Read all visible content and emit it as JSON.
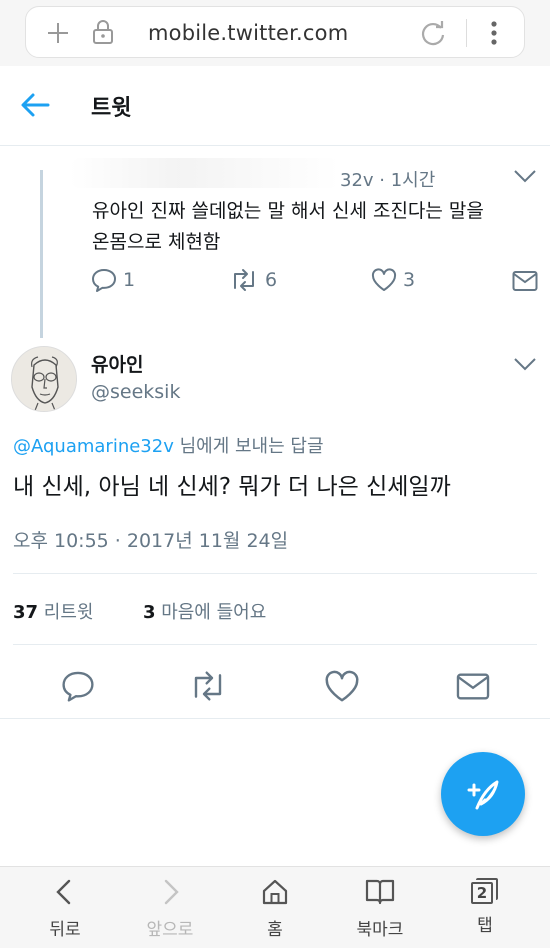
{
  "browser": {
    "url": "mobile.twitter.com",
    "icons": [
      "plus-icon",
      "lock-icon",
      "reload-icon",
      "more-vertical-icon"
    ]
  },
  "header": {
    "title": "트윗"
  },
  "parent_tweet": {
    "meta": "32v · 1시간",
    "text_line1": "유아인 진짜 쓸데없는 말 해서 신세 조진다는 말을",
    "text_line2": "온몸으로 체현함",
    "reply_count": "1",
    "retweet_count": "6",
    "like_count": "3"
  },
  "tweet": {
    "author_name": "유아인",
    "author_handle": "@seeksik",
    "reply_to_mention": "@Aquamarine32v",
    "reply_to_suffix": " 님에게 보내는 답글",
    "text": "내 신세, 아님 네 신세? 뭐가 더 나은 신세일까",
    "timestamp": "오후 10:55 · 2017년 11월 24일",
    "retweets_count": "37",
    "retweets_label": " 리트윗",
    "likes_count": "3",
    "likes_label": " 마음에 들어요"
  },
  "bottom_nav": {
    "back": "뒤로",
    "forward": "앞으로",
    "home": "홈",
    "bookmarks": "북마크",
    "tabs": "탭",
    "tabs_count": "2"
  },
  "colors": {
    "accent": "#1da1f2",
    "text_primary": "#14171a",
    "text_secondary": "#657786",
    "divider": "#e6ecf0"
  }
}
